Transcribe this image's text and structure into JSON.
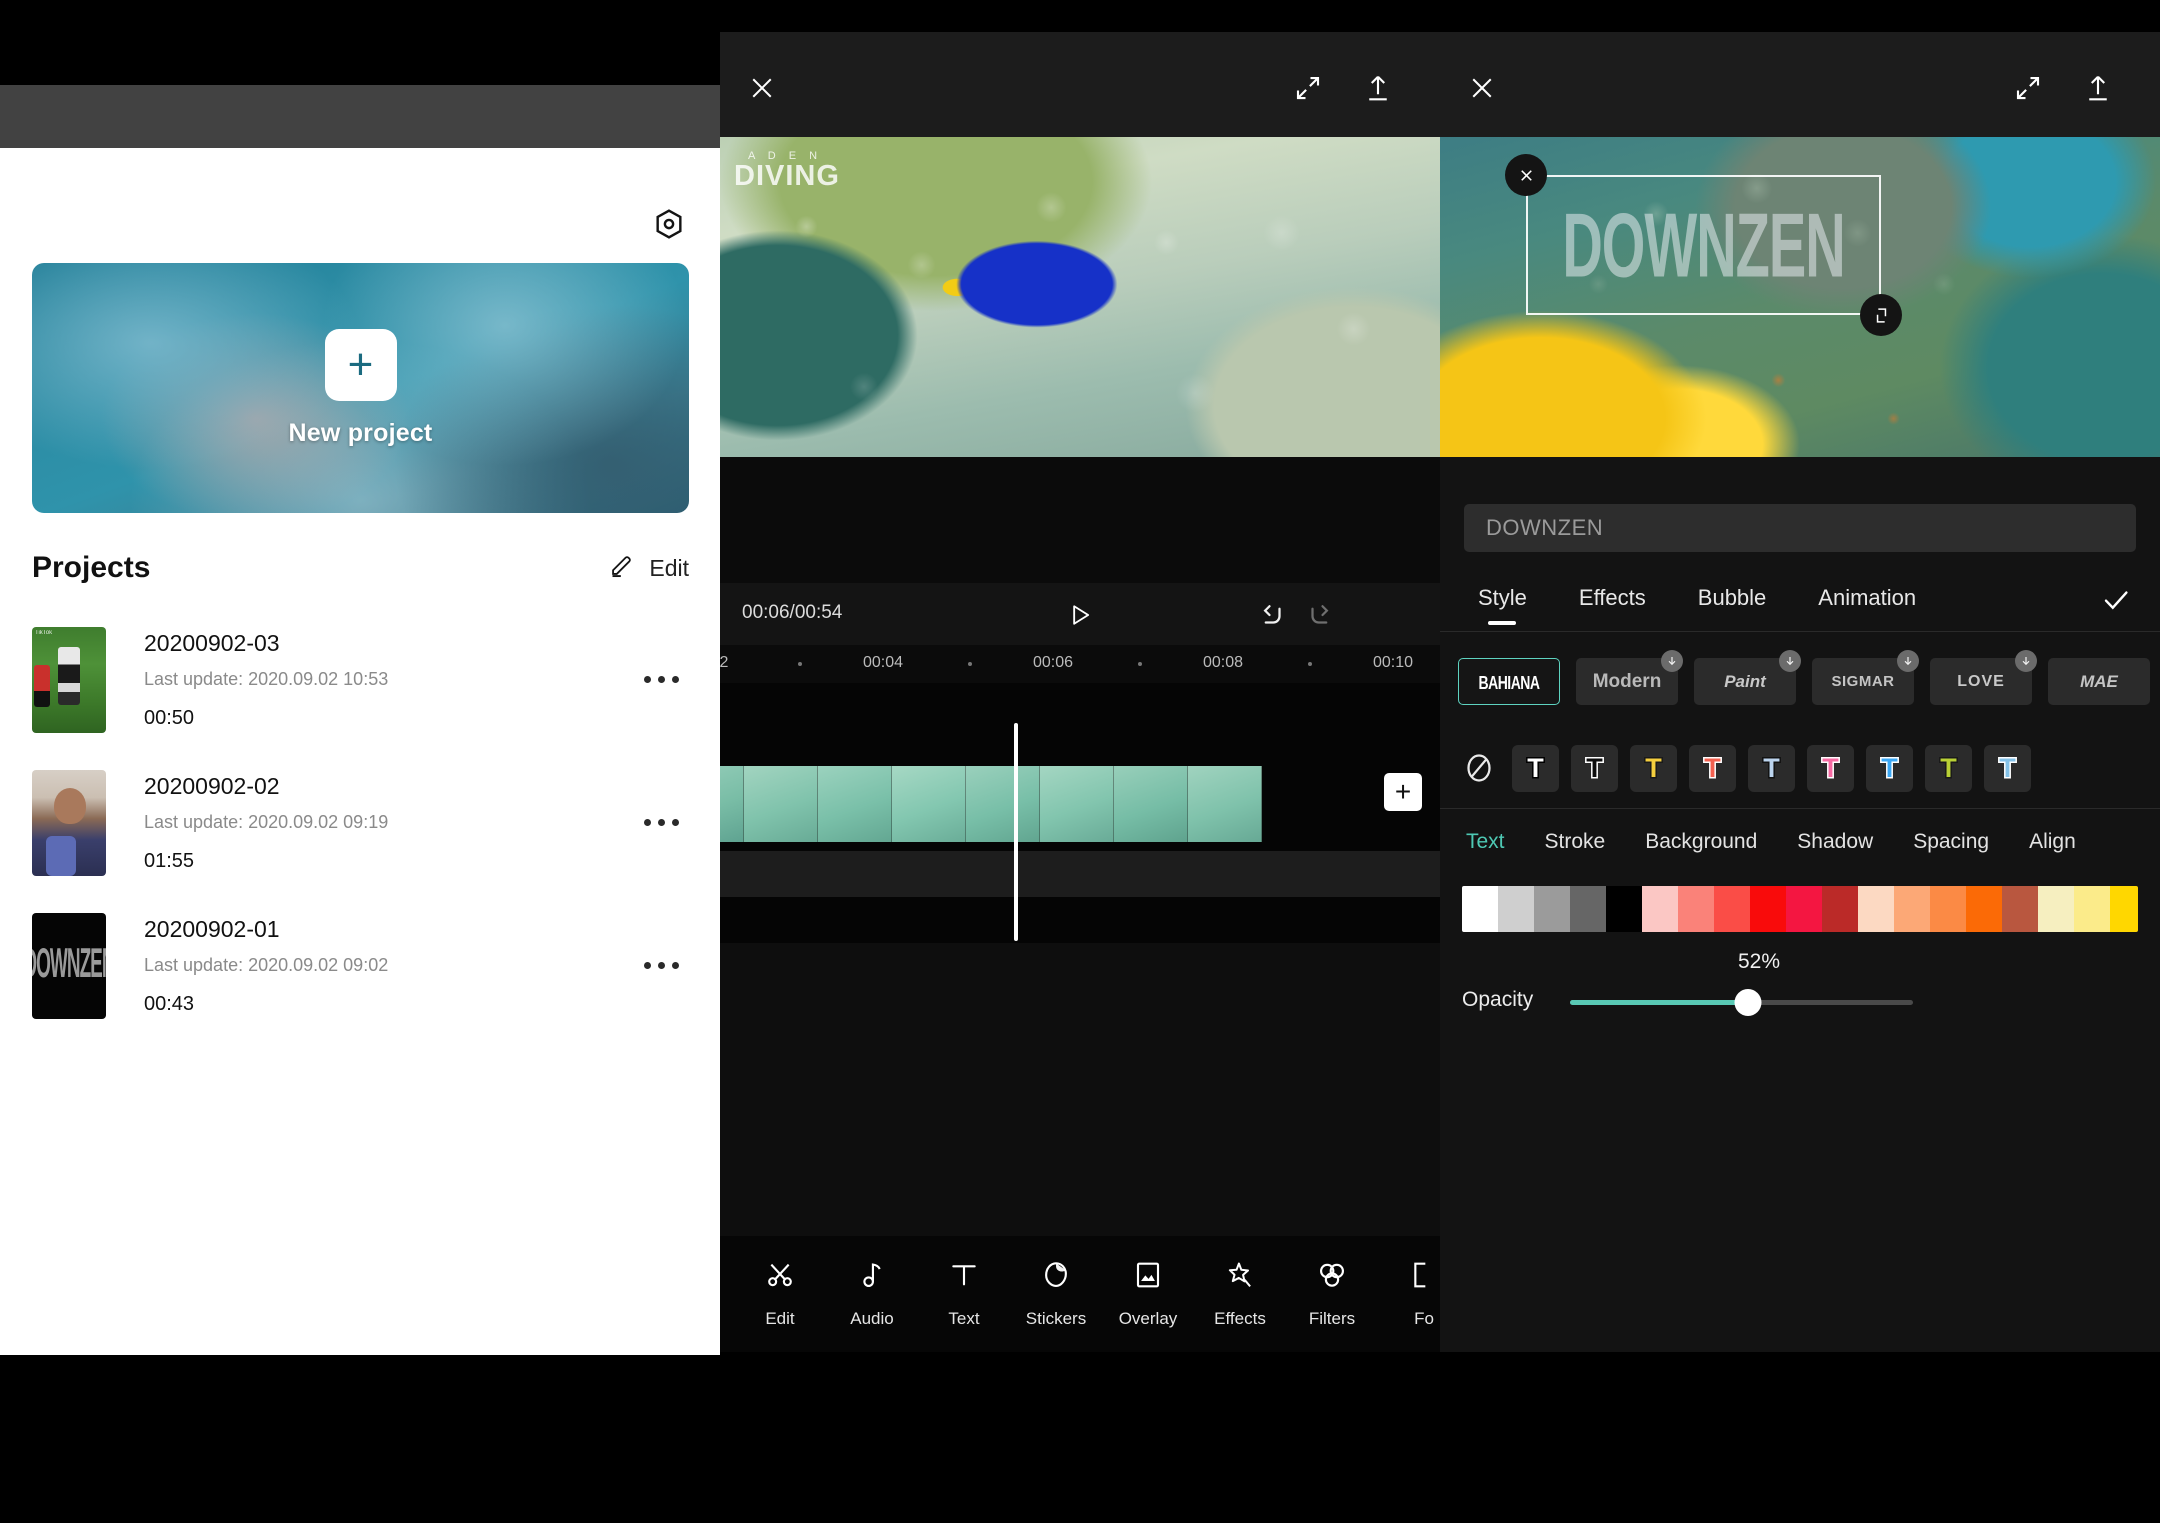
{
  "left_panel": {
    "gear_icon": "gear-icon",
    "new_project": {
      "label": "New project",
      "plus": "+"
    },
    "projects_header": {
      "title": "Projects",
      "edit_label": "Edit",
      "edit_icon": "pencil-icon"
    },
    "projects": [
      {
        "name": "20200902-03",
        "last_update": "Last update: 2020.09.02 10:53",
        "duration": "00:50",
        "thumb": "soccer-player-thumbnail",
        "thumb_badge": "TikTok"
      },
      {
        "name": "20200902-02",
        "last_update": "Last update: 2020.09.02 09:19",
        "duration": "01:55",
        "thumb": "person-selfie-thumbnail",
        "thumb_badge": ""
      },
      {
        "name": "20200902-01",
        "last_update": "Last update: 2020.09.02 09:02",
        "duration": "00:43",
        "thumb": "downzen-title-thumbnail",
        "thumb_text": "DOWNZEN",
        "thumb_badge": ""
      }
    ]
  },
  "middle_panel": {
    "topbar": {
      "close_icon": "close-icon",
      "fullscreen_icon": "expand-icon",
      "export_icon": "export-upload-icon"
    },
    "preview": {
      "watermark_top": "A D E N",
      "watermark_main": "DIVING"
    },
    "transport": {
      "time": "00:06/00:54",
      "play_icon": "play-icon",
      "undo_icon": "undo-icon",
      "redo_icon": "redo-icon"
    },
    "ruler": {
      "ticks": [
        "2",
        "00:04",
        "00:06",
        "00:08",
        "00:10"
      ]
    },
    "timeline": {
      "add_clip_label": "+",
      "playhead_position": "00:06"
    },
    "toolbar": [
      {
        "label": "Edit",
        "icon": "scissors-icon"
      },
      {
        "label": "Audio",
        "icon": "music-note-icon"
      },
      {
        "label": "Text",
        "icon": "text-t-icon"
      },
      {
        "label": "Stickers",
        "icon": "sticker-icon"
      },
      {
        "label": "Overlay",
        "icon": "image-frame-icon"
      },
      {
        "label": "Effects",
        "icon": "sparkle-star-icon"
      },
      {
        "label": "Filters",
        "icon": "three-circles-icon"
      },
      {
        "label": "Fo",
        "icon": "format-icon"
      }
    ]
  },
  "right_panel": {
    "topbar": {
      "close_icon": "close-icon",
      "fullscreen_icon": "expand-icon",
      "export_icon": "export-upload-icon"
    },
    "preview": {
      "overlay_text": "DOWNZEN",
      "close_handle_icon": "close-icon",
      "resize_handle_icon": "resize-icon"
    },
    "text_input": {
      "value": "DOWNZEN",
      "placeholder": "DOWNZEN"
    },
    "tabs": [
      {
        "label": "Style",
        "active": true
      },
      {
        "label": "Effects",
        "active": false
      },
      {
        "label": "Bubble",
        "active": false
      },
      {
        "label": "Animation",
        "active": false
      }
    ],
    "confirm_icon": "check-icon",
    "fonts": [
      {
        "name": "BAHIANA",
        "selected": true,
        "downloadable": false,
        "cls": "fc-bahiana"
      },
      {
        "name": "Modern",
        "selected": false,
        "downloadable": true,
        "cls": "fc-modern"
      },
      {
        "name": "Paint",
        "selected": false,
        "downloadable": true,
        "cls": "fc-paint"
      },
      {
        "name": "SIGMAR",
        "selected": false,
        "downloadable": true,
        "cls": "fc-sigmar"
      },
      {
        "name": "LOVE",
        "selected": false,
        "downloadable": true,
        "cls": "fc-love"
      },
      {
        "name": "MAE",
        "selected": false,
        "downloadable": false,
        "cls": "fc-mae"
      }
    ],
    "text_styles": [
      {
        "id": "none",
        "icon": "no-style-icon"
      },
      {
        "id": "white-black-stroke",
        "fill": "#ffffff",
        "stroke": "#000000"
      },
      {
        "id": "black-white-stroke",
        "fill": "#101010",
        "stroke": "#ffffff"
      },
      {
        "id": "yellow-black-stroke",
        "fill": "#f5cf3e",
        "stroke": "#1a1a1a"
      },
      {
        "id": "red-white-stroke",
        "fill": "#f4604f",
        "stroke": "#ffffff"
      },
      {
        "id": "lightblue-black-stroke",
        "fill": "#bcd4ee",
        "stroke": "#121212"
      },
      {
        "id": "pink-white-stroke",
        "fill": "#f76aa3",
        "stroke": "#ffffff"
      },
      {
        "id": "blue-white-stroke",
        "fill": "#3ba8f5",
        "stroke": "#ffffff"
      },
      {
        "id": "green-black-stroke",
        "fill": "#b9d135",
        "stroke": "#1a1a1a"
      },
      {
        "id": "skyblue-white-stroke",
        "fill": "#84c2e8",
        "stroke": "#ffffff"
      }
    ],
    "sub_tabs": [
      {
        "label": "Text",
        "active": true
      },
      {
        "label": "Stroke",
        "active": false
      },
      {
        "label": "Background",
        "active": false
      },
      {
        "label": "Shadow",
        "active": false
      },
      {
        "label": "Spacing",
        "active": false
      },
      {
        "label": "Align",
        "active": false
      }
    ],
    "color_swatches": [
      "#ffffff",
      "#cfcfcf",
      "#9b9b9b",
      "#666666",
      "#000000",
      "#fbc7c4",
      "#fa8279",
      "#fa4d47",
      "#f90b0b",
      "#f41641",
      "#bb2a28",
      "#fcd9c2",
      "#fca876",
      "#fb8a45",
      "#fb6a06",
      "#b9573f",
      "#f6efc0",
      "#fbeb8a",
      "#ffd700",
      "#fcc01c"
    ],
    "opacity": {
      "label": "Opacity",
      "value": "52%",
      "percent": 52,
      "accent": "#59c9b4"
    }
  }
}
